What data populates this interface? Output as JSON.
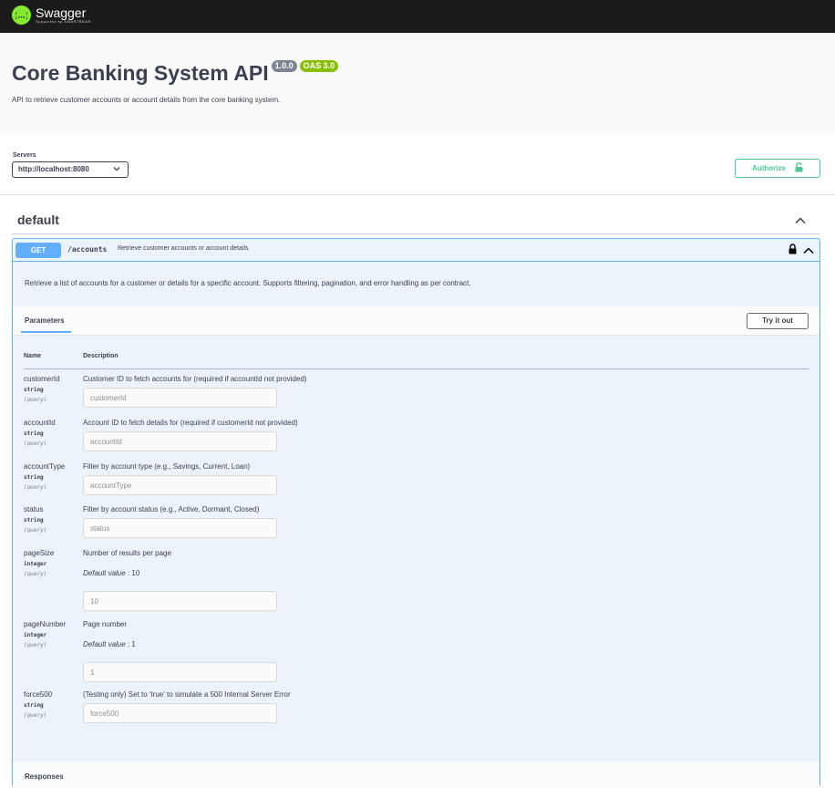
{
  "topbar": {
    "logo_title": "Swagger",
    "logo_sub": "Supported by SMARTBEAR",
    "logo_color": "#85ea2d"
  },
  "info": {
    "title": "Core Banking System API",
    "version": "1.0.0",
    "oas": "OAS 3.0",
    "description": "API to retrieve customer accounts or account details from the core banking system."
  },
  "servers": {
    "label": "Servers",
    "selected": "http://localhost:8080"
  },
  "authorize": {
    "label": "Authorize",
    "color": "#49cc90"
  },
  "tag": {
    "name": "default"
  },
  "operation": {
    "method": "GET",
    "path": "/accounts",
    "summary": "Retrieve customer accounts or account details",
    "description": "Retrieve a list of accounts for a customer or details for a specific account. Supports filtering, pagination, and error handling as per contract.",
    "method_color": "#61affe",
    "tab_label": "Parameters",
    "try_label": "Try it out",
    "col_name": "Name",
    "col_description": "Description",
    "responses_label": "Responses"
  },
  "params": [
    {
      "name": "customerId",
      "type": "string",
      "in": "(query)",
      "description": "Customer ID to fetch accounts for (required if accountId not provided)",
      "placeholder": "customerId"
    },
    {
      "name": "accountId",
      "type": "string",
      "in": "(query)",
      "description": "Account ID to fetch details for (required if customerId not provided)",
      "placeholder": "accountId"
    },
    {
      "name": "accountType",
      "type": "string",
      "in": "(query)",
      "description": "Filter by account type (e.g., Savings, Current, Loan)",
      "placeholder": "accountType"
    },
    {
      "name": "status",
      "type": "string",
      "in": "(query)",
      "description": "Filter by account status (e.g., Active, Dormant, Closed)",
      "placeholder": "status"
    },
    {
      "name": "pageSize",
      "type": "integer",
      "in": "(query)",
      "description": "Number of results per page",
      "default_label": "Default value",
      "default_value": ": 10",
      "placeholder": "10"
    },
    {
      "name": "pageNumber",
      "type": "integer",
      "in": "(query)",
      "description": "Page number",
      "default_label": "Default value",
      "default_value": ": 1",
      "placeholder": "1"
    },
    {
      "name": "force500",
      "type": "string",
      "in": "(query)",
      "description": "(Testing only) Set to 'true' to simulate a 500 Internal Server Error",
      "placeholder": "force500"
    }
  ]
}
